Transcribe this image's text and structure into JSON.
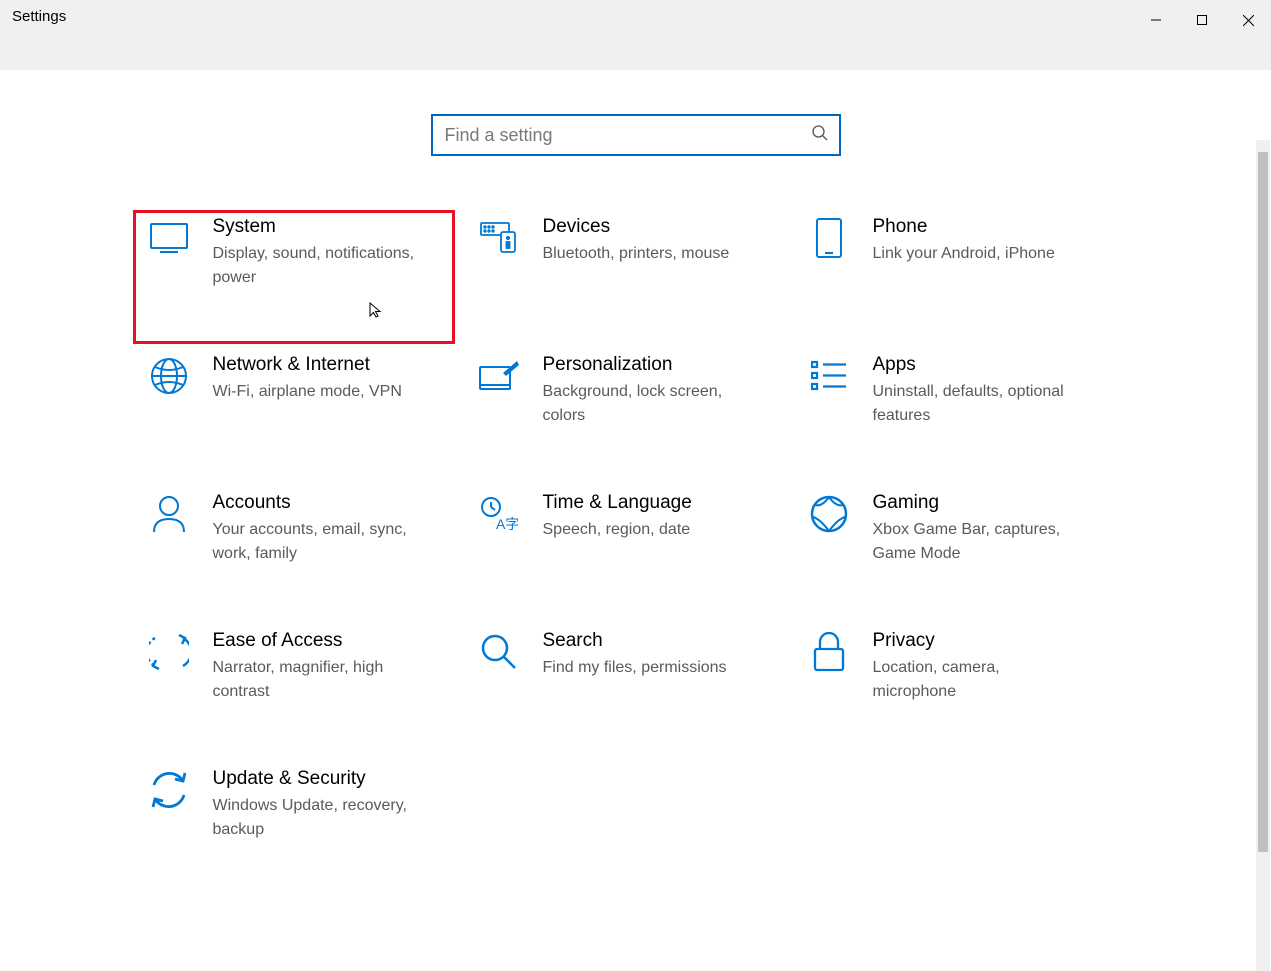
{
  "window": {
    "title": "Settings"
  },
  "search": {
    "placeholder": "Find a setting"
  },
  "categories": [
    {
      "id": "system",
      "title": "System",
      "desc": "Display, sound, notifications, power"
    },
    {
      "id": "devices",
      "title": "Devices",
      "desc": "Bluetooth, printers, mouse"
    },
    {
      "id": "phone",
      "title": "Phone",
      "desc": "Link your Android, iPhone"
    },
    {
      "id": "network",
      "title": "Network & Internet",
      "desc": "Wi-Fi, airplane mode, VPN"
    },
    {
      "id": "personalization",
      "title": "Personalization",
      "desc": "Background, lock screen, colors"
    },
    {
      "id": "apps",
      "title": "Apps",
      "desc": "Uninstall, defaults, optional features"
    },
    {
      "id": "accounts",
      "title": "Accounts",
      "desc": "Your accounts, email, sync, work, family"
    },
    {
      "id": "time",
      "title": "Time & Language",
      "desc": "Speech, region, date"
    },
    {
      "id": "gaming",
      "title": "Gaming",
      "desc": "Xbox Game Bar, captures, Game Mode"
    },
    {
      "id": "ease",
      "title": "Ease of Access",
      "desc": "Narrator, magnifier, high contrast"
    },
    {
      "id": "search",
      "title": "Search",
      "desc": "Find my files, permissions"
    },
    {
      "id": "privacy",
      "title": "Privacy",
      "desc": "Location, camera, microphone"
    },
    {
      "id": "update",
      "title": "Update & Security",
      "desc": "Windows Update, recovery, backup"
    }
  ],
  "highlighted_category": "system",
  "colors": {
    "accent": "#0078d4",
    "highlight": "#e81123"
  }
}
